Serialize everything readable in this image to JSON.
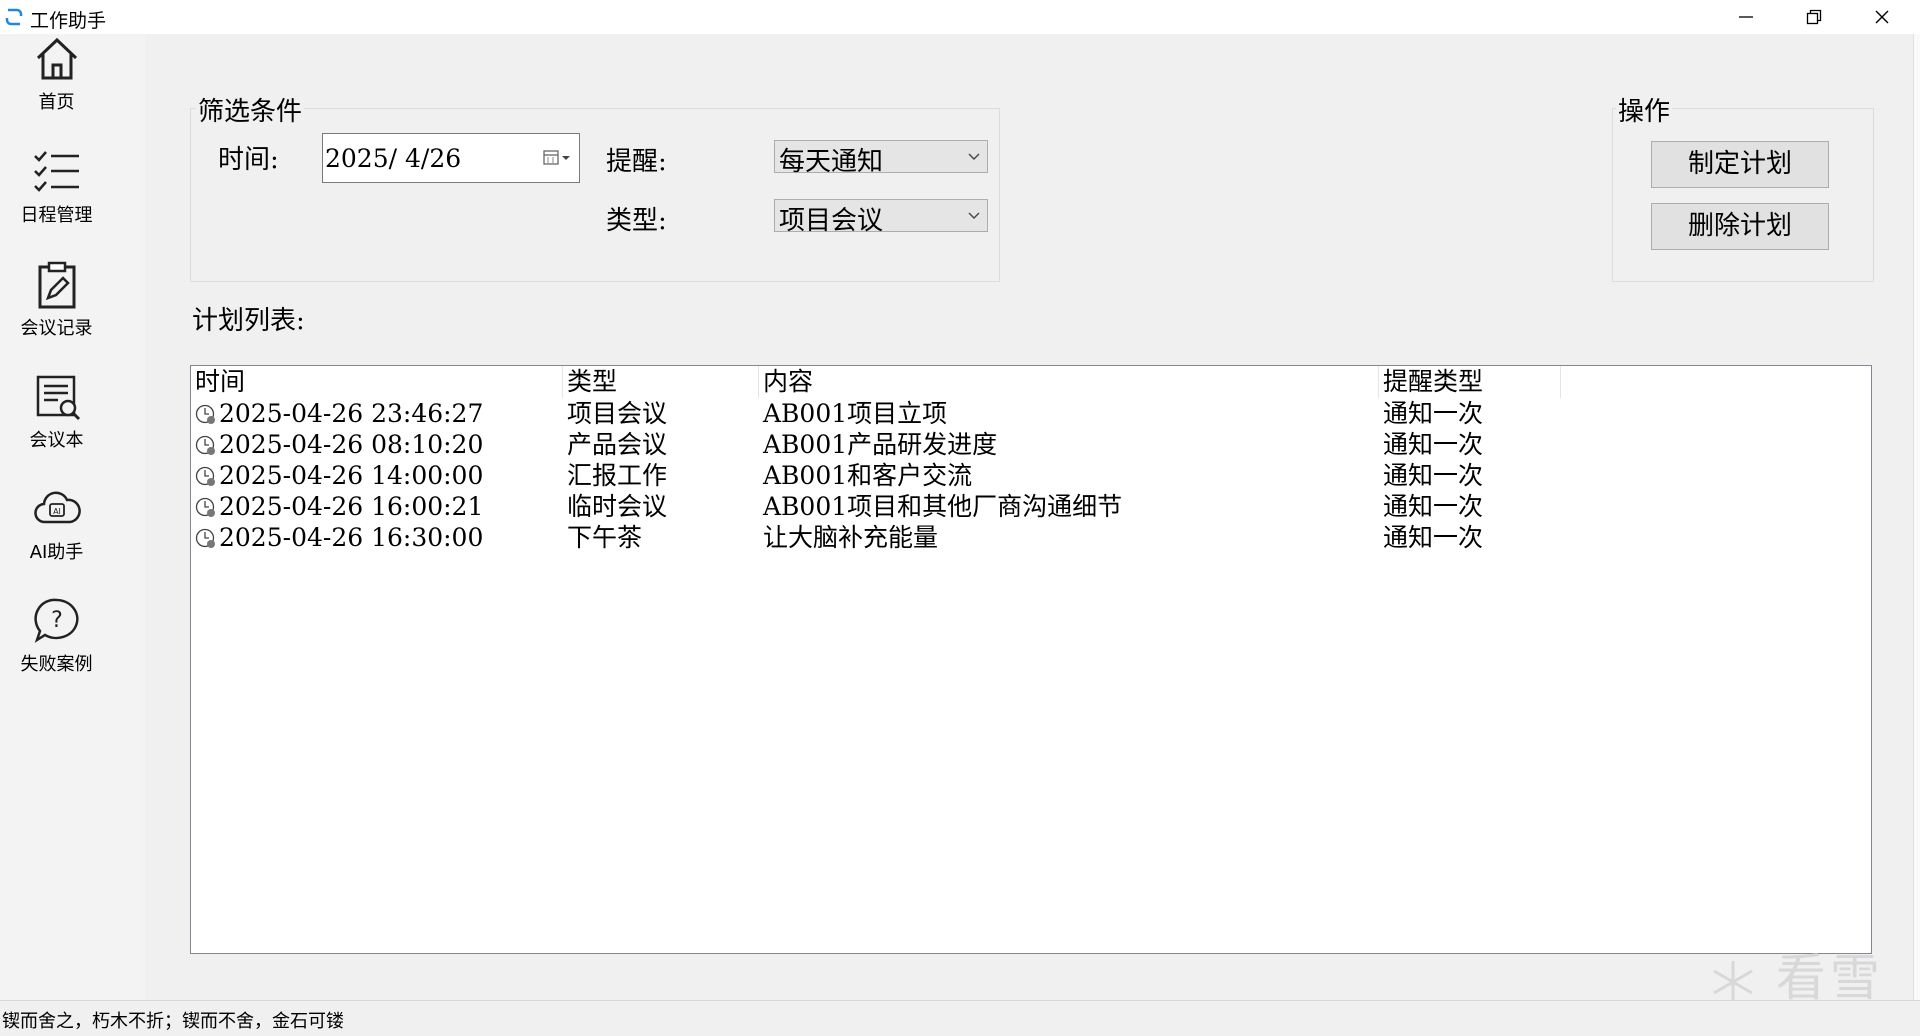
{
  "window": {
    "title": "工作助手"
  },
  "sidebar": {
    "items": [
      {
        "label": "首页",
        "icon": "home-icon"
      },
      {
        "label": "日程管理",
        "icon": "checklist-icon"
      },
      {
        "label": "会议记录",
        "icon": "clipboard-edit-icon"
      },
      {
        "label": "会议本",
        "icon": "document-search-icon"
      },
      {
        "label": "AI助手",
        "icon": "ai-cloud-icon"
      },
      {
        "label": "失败案例",
        "icon": "question-bubble-icon"
      }
    ]
  },
  "filter": {
    "group_label": "筛选条件",
    "time_label": "时间:",
    "date_value": "2025/ 4/26",
    "remind_label": "提醒:",
    "remind_value": "每天通知",
    "type_label": "类型:",
    "type_value": "项目会议"
  },
  "actions": {
    "group_label": "操作",
    "make_plan": "制定计划",
    "delete_plan": "删除计划"
  },
  "plan_list": {
    "label": "计划列表:",
    "columns": [
      "时间",
      "类型",
      "内容",
      "提醒类型"
    ],
    "rows": [
      {
        "time": "2025-04-26 23:46:27",
        "type": "项目会议",
        "content": "AB001项目立项",
        "remind": "通知一次"
      },
      {
        "time": "2025-04-26 08:10:20",
        "type": "产品会议",
        "content": "AB001产品研发进度",
        "remind": "通知一次"
      },
      {
        "time": "2025-04-26 14:00:00",
        "type": "汇报工作",
        "content": "AB001和客户交流",
        "remind": "通知一次"
      },
      {
        "time": "2025-04-26 16:00:21",
        "type": "临时会议",
        "content": "AB001项目和其他厂商沟通细节",
        "remind": "通知一次"
      },
      {
        "time": "2025-04-26 16:30:00",
        "type": "下午茶",
        "content": "让大脑补充能量",
        "remind": "通知一次"
      }
    ]
  },
  "status_bar": {
    "text": "锲而舍之，朽木不折；锲而不舍，金石可镂"
  },
  "watermark": {
    "text": "看雪"
  }
}
